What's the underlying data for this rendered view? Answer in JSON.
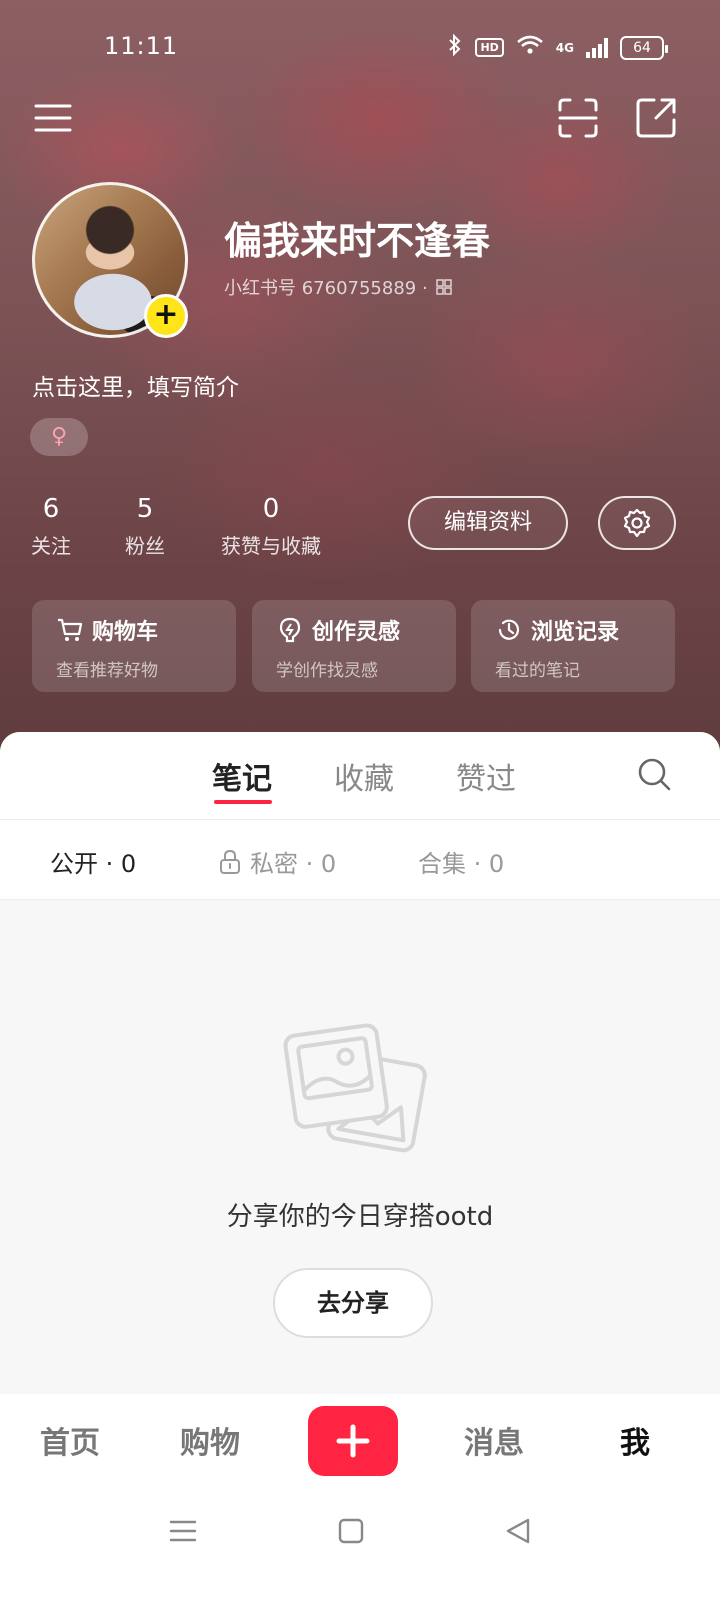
{
  "status_bar": {
    "time": "11:11",
    "network": "4G",
    "hd": "HD",
    "battery": "64"
  },
  "profile": {
    "nickname": "偏我来时不逢春",
    "red_id": "小红书号 6760755889 ·",
    "bio": "点击这里，填写简介",
    "gender_symbol": "♀",
    "gender_color": "#ff9fb4"
  },
  "stats": {
    "following": {
      "count": "6",
      "label": "关注"
    },
    "followers": {
      "count": "5",
      "label": "粉丝"
    },
    "likes": {
      "count": "0",
      "label": "获赞与收藏"
    }
  },
  "actions": {
    "edit_profile": "编辑资料"
  },
  "quick_cards": {
    "cart": {
      "title": "购物车",
      "sub": "查看推荐好物"
    },
    "inspiration": {
      "title": "创作灵感",
      "sub": "学创作找灵感"
    },
    "history": {
      "title": "浏览记录",
      "sub": "看过的笔记"
    }
  },
  "tabs": {
    "notes": "笔记",
    "collections": "收藏",
    "liked": "赞过"
  },
  "subtabs": {
    "public": "公开 · 0",
    "private": "私密 · 0",
    "collection": "合集 · 0"
  },
  "empty_state": {
    "text": "分享你的今日穿搭ootd",
    "button": "去分享"
  },
  "bottom_nav": {
    "home": "首页",
    "shopping": "购物",
    "messages": "消息",
    "me": "我"
  },
  "colors": {
    "accent": "#ff2442",
    "avatar_add": "#ffe41a"
  }
}
